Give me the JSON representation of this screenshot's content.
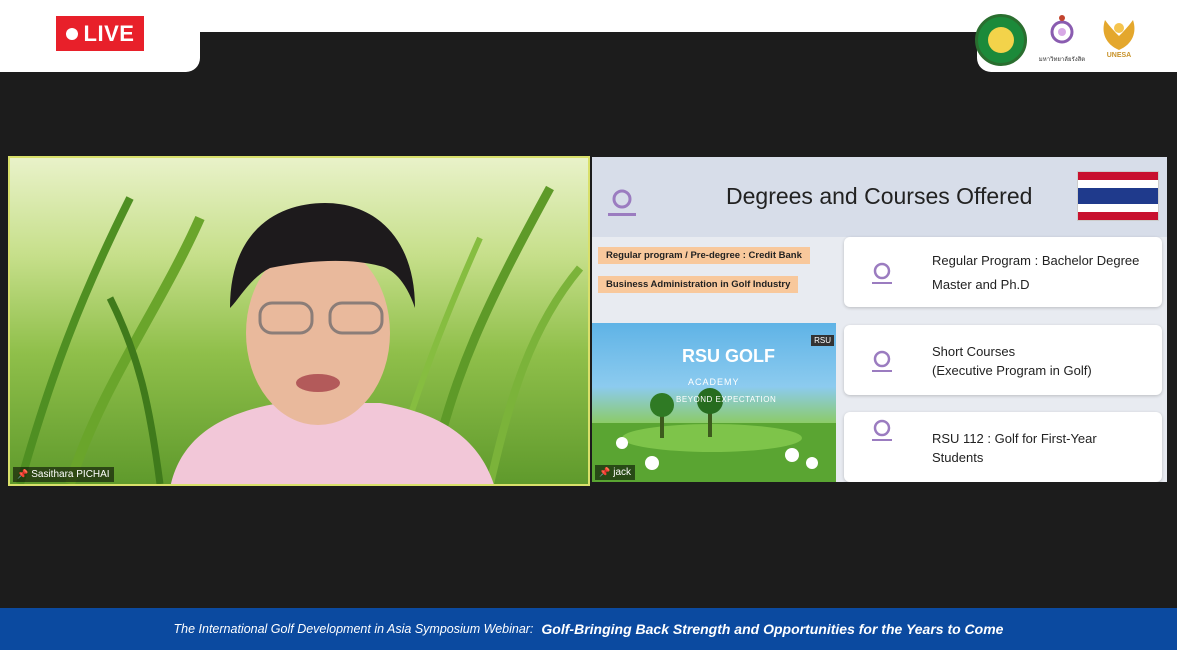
{
  "live_label": "LIVE",
  "logos": {
    "rsu_caption": "มหาวิทยาลัยรังสิต",
    "unesa_caption": "UNESA"
  },
  "participants": {
    "speaker_name": "Sasithara PICHAI",
    "share_name": "jack"
  },
  "slide": {
    "title": "Degrees and Courses Offered",
    "pill_1": "Regular program / Pre-degree : Credit Bank",
    "pill_2": "Business Administration in Golf Industry",
    "golf": {
      "title_line1": "RSU GOLF",
      "title_line2": "ACADEMY",
      "tagline": "BEYOND EXPECTATION",
      "badge": "RSU"
    },
    "cards": [
      {
        "line1": "Regular Program :  Bachelor Degree",
        "line2": "Master and  Ph.D"
      },
      {
        "line1": "Short Courses",
        "line2": "(Executive Program in Golf)"
      },
      {
        "line1": "RSU 112 : Golf for First-Year",
        "line2": "Students"
      }
    ]
  },
  "banner": {
    "left": "The International Golf Development in Asia Symposium Webinar:",
    "right": "Golf-Bringing Back Strength and Opportunities for the Years to Come"
  },
  "colors": {
    "live_red": "#e8202a",
    "banner_blue": "#0b4aa0",
    "speaker_border": "#d9e06a"
  }
}
